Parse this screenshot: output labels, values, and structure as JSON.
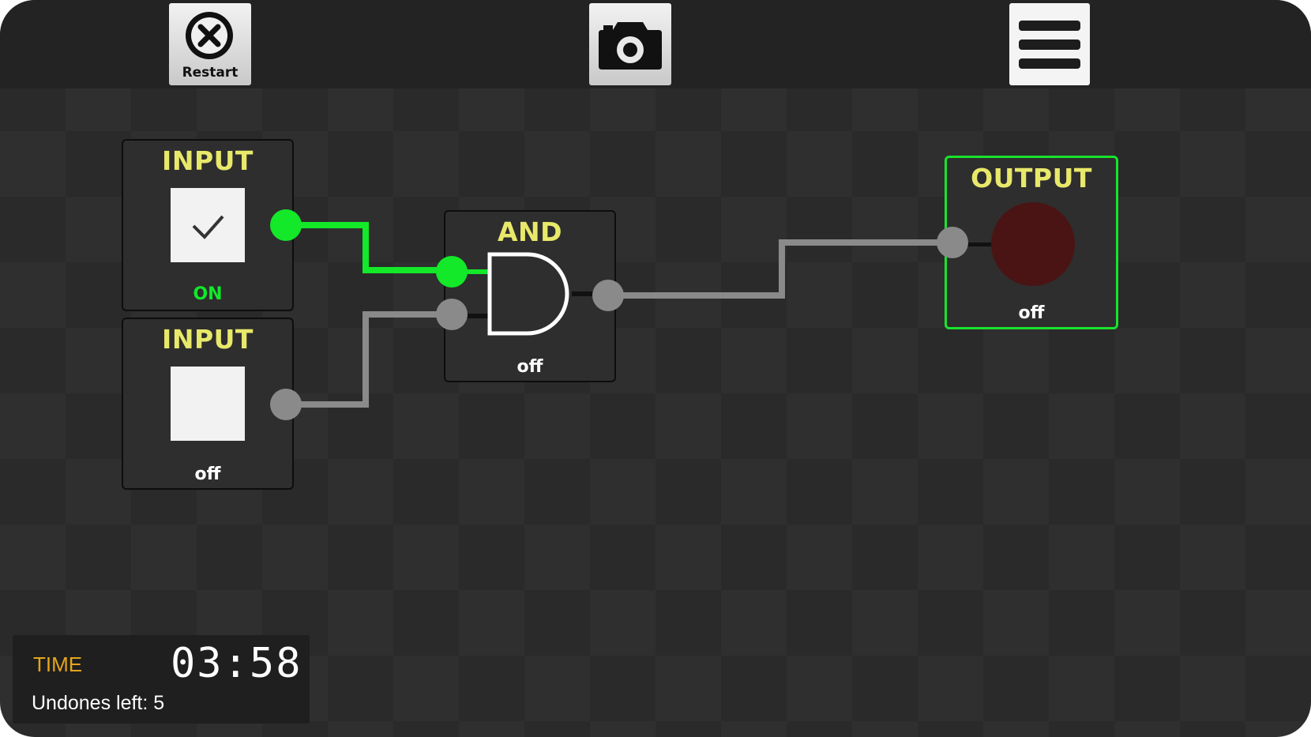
{
  "toolbar": {
    "restart_label": "Restart",
    "restart_icon": "close-circle-icon",
    "camera_icon": "camera-icon",
    "menu_icon": "hamburger-menu-icon"
  },
  "nodes": {
    "input1": {
      "title": "INPUT",
      "state": "ON",
      "checked": true
    },
    "input2": {
      "title": "INPUT",
      "state": "off",
      "checked": false
    },
    "and_gate": {
      "title": "AND",
      "state": "off"
    },
    "output": {
      "title": "OUTPUT",
      "state": "off",
      "lit": false
    }
  },
  "hud": {
    "time_label": "TIME",
    "time_value": "03:58",
    "undo_text": "Undones left: 5"
  },
  "colors": {
    "active_wire": "#13e829",
    "inactive_wire": "#8a8a8a",
    "title": "#e8e86a",
    "time_label": "#e5a51b",
    "output_off": "#4a1414"
  }
}
